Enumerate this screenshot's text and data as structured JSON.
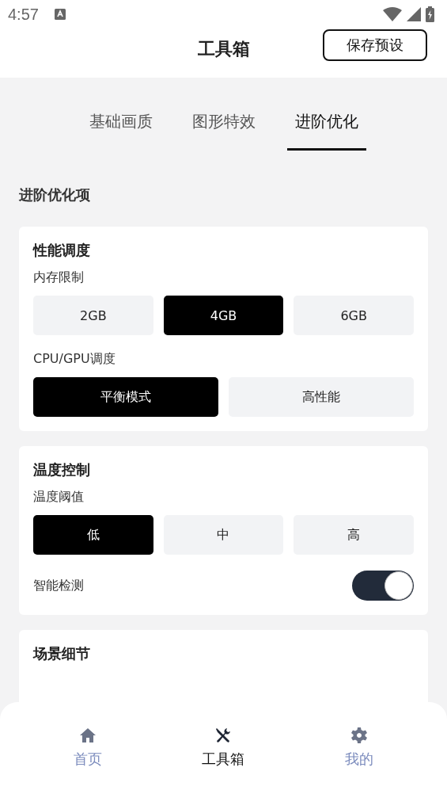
{
  "status_bar": {
    "time": "4:57"
  },
  "header": {
    "title": "工具箱",
    "action": "保存预设"
  },
  "tabs": [
    {
      "label": "基础画质",
      "selected": false
    },
    {
      "label": "图形特效",
      "selected": false
    },
    {
      "label": "进阶优化",
      "selected": true
    }
  ],
  "section_title": "进阶优化项",
  "cards": [
    {
      "title": "性能调度",
      "rows": [
        {
          "kind": "options",
          "label": "内存限制",
          "options": [
            {
              "label": "2GB",
              "selected": false
            },
            {
              "label": "4GB",
              "selected": true
            },
            {
              "label": "6GB",
              "selected": false
            }
          ]
        },
        {
          "kind": "options",
          "label": "CPU/GPU调度",
          "options": [
            {
              "label": "平衡模式",
              "selected": true
            },
            {
              "label": "高性能",
              "selected": false
            }
          ]
        }
      ]
    },
    {
      "title": "温度控制",
      "rows": [
        {
          "kind": "options",
          "label": "温度阈值",
          "options": [
            {
              "label": "低",
              "selected": true
            },
            {
              "label": "中",
              "selected": false
            },
            {
              "label": "高",
              "selected": false
            }
          ]
        },
        {
          "kind": "toggle",
          "label": "智能检测",
          "on": true
        }
      ]
    },
    {
      "title": "场景细节"
    }
  ],
  "bottom_nav": [
    {
      "kind": "home",
      "label": "首页",
      "selected": false
    },
    {
      "kind": "tools",
      "label": "工具箱",
      "selected": true
    },
    {
      "kind": "settings",
      "label": "我的",
      "selected": false
    }
  ]
}
